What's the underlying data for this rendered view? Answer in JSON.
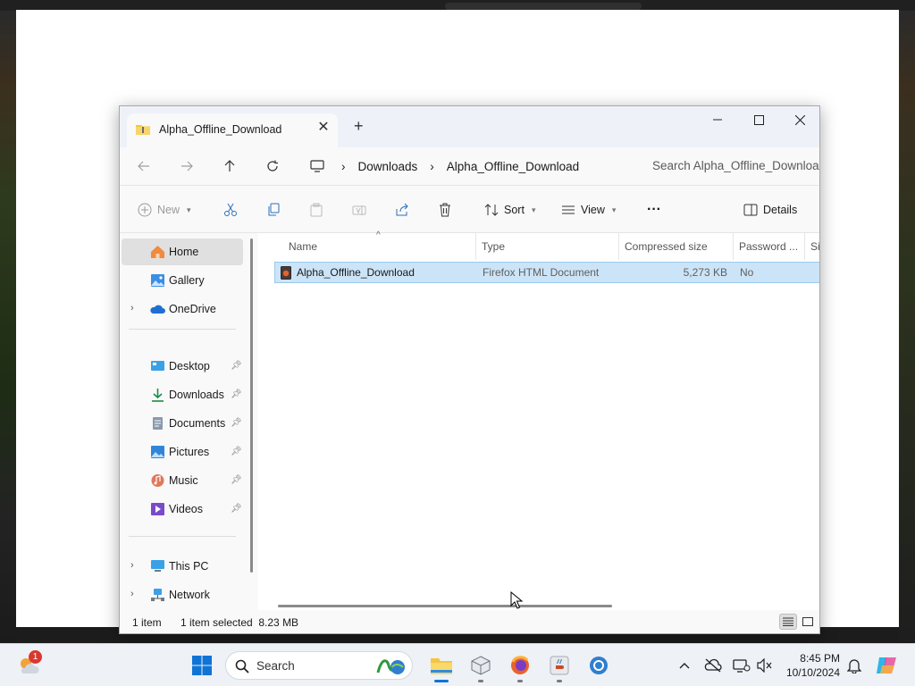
{
  "window": {
    "tab_title": "Alpha_Offline_Download",
    "close_glyph": "✕",
    "new_tab_glyph": "+"
  },
  "address": {
    "crumbs": [
      "Downloads",
      "Alpha_Offline_Download"
    ],
    "search_placeholder": "Search Alpha_Offline_Download"
  },
  "toolbar": {
    "new_label": "New",
    "sort_label": "Sort",
    "view_label": "View",
    "more_label": "···",
    "details_label": "Details"
  },
  "sidebar": {
    "items": [
      {
        "label": "Home",
        "icon": "home-icon"
      },
      {
        "label": "Gallery",
        "icon": "gallery-icon"
      },
      {
        "label": "OneDrive",
        "icon": "onedrive-icon"
      },
      {
        "label": "Desktop",
        "icon": "desktop-icon"
      },
      {
        "label": "Downloads",
        "icon": "download-icon"
      },
      {
        "label": "Documents",
        "icon": "documents-icon"
      },
      {
        "label": "Pictures",
        "icon": "pictures-icon"
      },
      {
        "label": "Music",
        "icon": "music-icon"
      },
      {
        "label": "Videos",
        "icon": "videos-icon"
      },
      {
        "label": "This PC",
        "icon": "computer-icon"
      },
      {
        "label": "Network",
        "icon": "network-icon"
      }
    ]
  },
  "table": {
    "columns": [
      "Name",
      "Type",
      "Compressed size",
      "Password ...",
      "Si"
    ],
    "rows": [
      {
        "name": "Alpha_Offline_Download",
        "type": "Firefox HTML Document",
        "compressed_size": "5,273 KB",
        "password": "No"
      }
    ]
  },
  "status": {
    "item_count": "1 item",
    "selection": "1 item selected  8.23 MB"
  },
  "taskbar": {
    "search_label": "Search",
    "time": "8:45 PM",
    "date": "10/10/2024",
    "weather_badge": "1"
  },
  "colors": {
    "selection": "#cce4f7",
    "folder": "#f4c542",
    "accent": "#0078d4"
  }
}
